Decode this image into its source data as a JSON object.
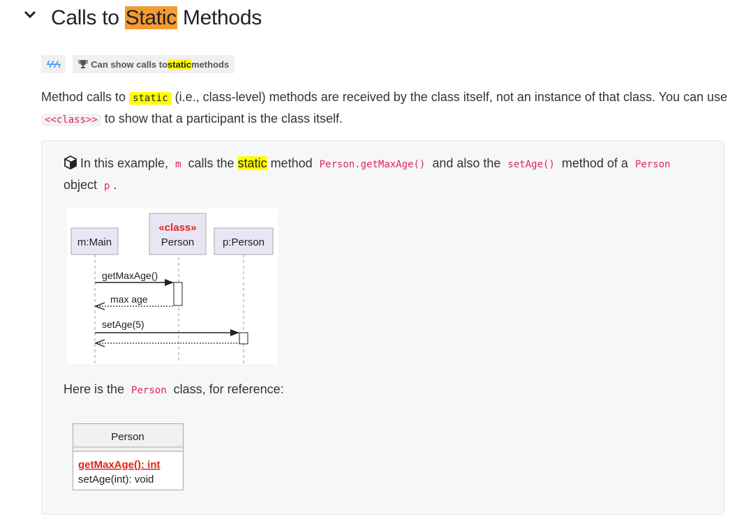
{
  "section": {
    "title_prefix": "Calls to ",
    "title_highlight": "Static",
    "title_suffix": " Methods"
  },
  "badges": {
    "bolts": "ϟϟϟ",
    "achievement_prefix": "Can show calls to ",
    "achievement_highlight": "static",
    "achievement_suffix": " methods"
  },
  "intro": {
    "t1": "Method calls to ",
    "code_static": "static",
    "t2": " (i.e., class-level) methods are received by the class itself, not an instance of that class. You can use ",
    "code_class": "<<class>>",
    "t3": " to show that a participant is the class itself."
  },
  "example": {
    "t1": "In this example, ",
    "code_m": "m",
    "t2": " calls the ",
    "hl_static": "static",
    "t3": " method ",
    "code_getmax": "Person.getMaxAge()",
    "t4": " and also the ",
    "code_setage": "setAge()",
    "t5": " method of a ",
    "code_person": "Person",
    "t6": " object ",
    "code_p": "p",
    "t7": "."
  },
  "diagram": {
    "participant_main": "m:Main",
    "stereotype": "«class»",
    "participant_class": "Person",
    "participant_obj": "p:Person",
    "msg1": "getMaxAge()",
    "ret1": "max age",
    "msg2": "setAge(5)"
  },
  "reference": {
    "t1": "Here is the ",
    "code_person": "Person",
    "t2": " class, for reference:"
  },
  "class_diagram": {
    "name": "Person",
    "method_static": "getMaxAge(): int",
    "method_instance": "setAge(int): void"
  },
  "colors": {
    "highlight_orange": "#f59b33",
    "highlight_yellow": "#ffff00",
    "code_red": "#e0245e",
    "uml_red": "#e0241a"
  }
}
